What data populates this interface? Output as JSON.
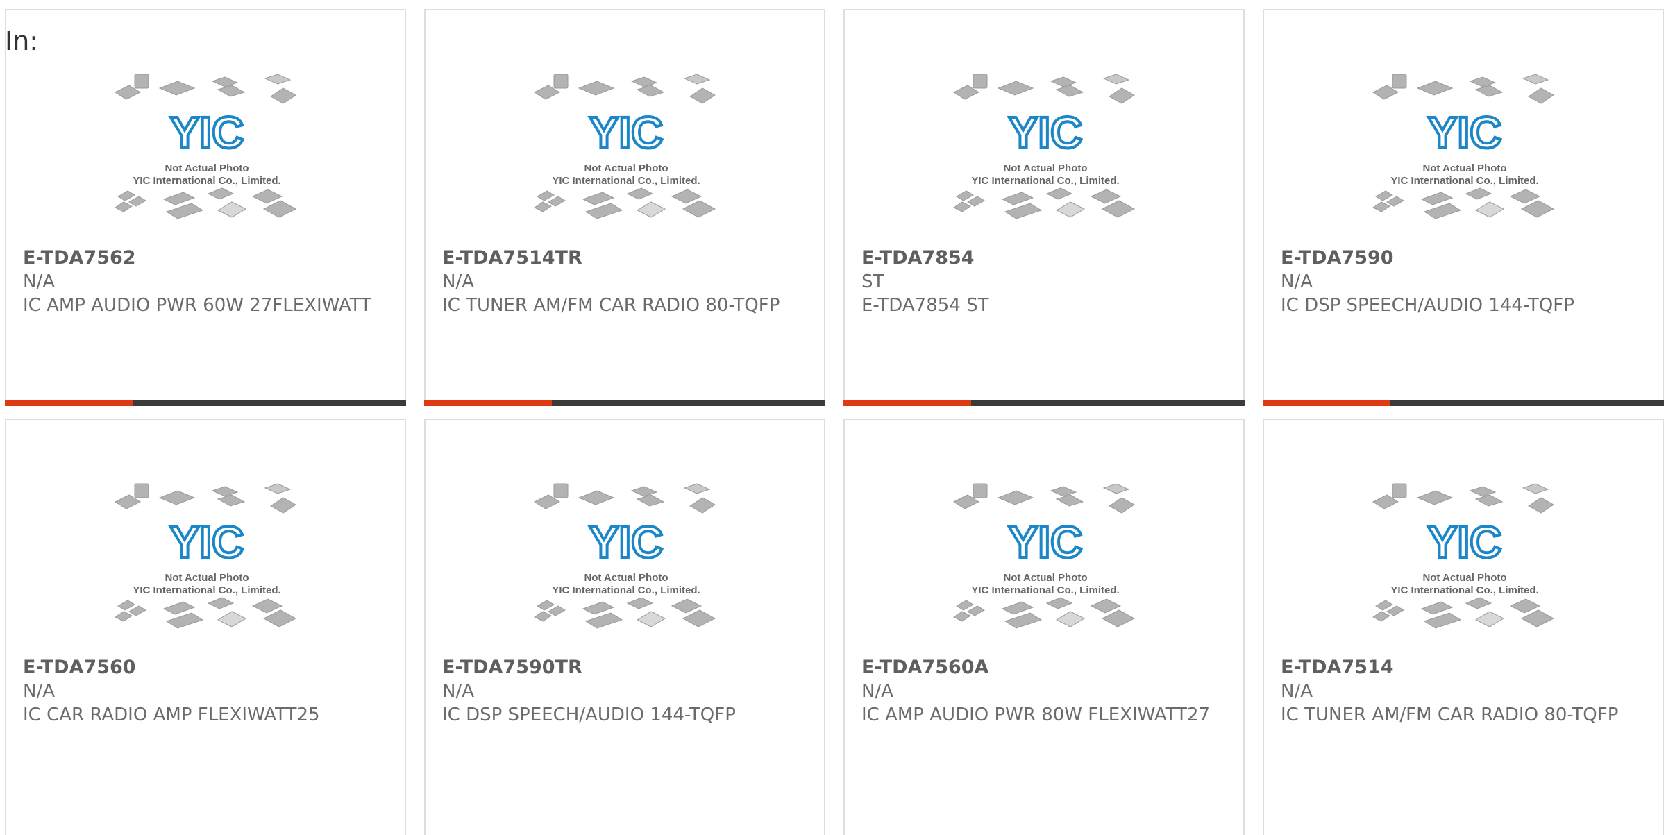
{
  "filter": {
    "label": "In:"
  },
  "placeholder_image": {
    "logo_text": "YIC",
    "line1": "Not Actual Photo",
    "line2": "YIC International Co., Limited."
  },
  "colors": {
    "accent": "#e03a12",
    "bar": "#3b3b3b",
    "logo_blue": "#1b87c9"
  },
  "products": [
    {
      "part": "E-TDA7562",
      "manufacturer": "N/A",
      "description": "IC AMP AUDIO PWR 60W 27FLEXIWATT"
    },
    {
      "part": "E-TDA7514TR",
      "manufacturer": "N/A",
      "description": "IC TUNER AM/FM CAR RADIO 80-TQFP"
    },
    {
      "part": "E-TDA7854",
      "manufacturer": "ST",
      "description": "E-TDA7854 ST"
    },
    {
      "part": "E-TDA7590",
      "manufacturer": "N/A",
      "description": "IC DSP SPEECH/AUDIO 144-TQFP"
    },
    {
      "part": "E-TDA7560",
      "manufacturer": "N/A",
      "description": "IC CAR RADIO AMP FLEXIWATT25"
    },
    {
      "part": "E-TDA7590TR",
      "manufacturer": "N/A",
      "description": "IC DSP SPEECH/AUDIO 144-TQFP"
    },
    {
      "part": "E-TDA7560A",
      "manufacturer": "N/A",
      "description": "IC AMP AUDIO PWR 80W FLEXIWATT27"
    },
    {
      "part": "E-TDA7514",
      "manufacturer": "N/A",
      "description": "IC TUNER AM/FM CAR RADIO 80-TQFP"
    }
  ]
}
